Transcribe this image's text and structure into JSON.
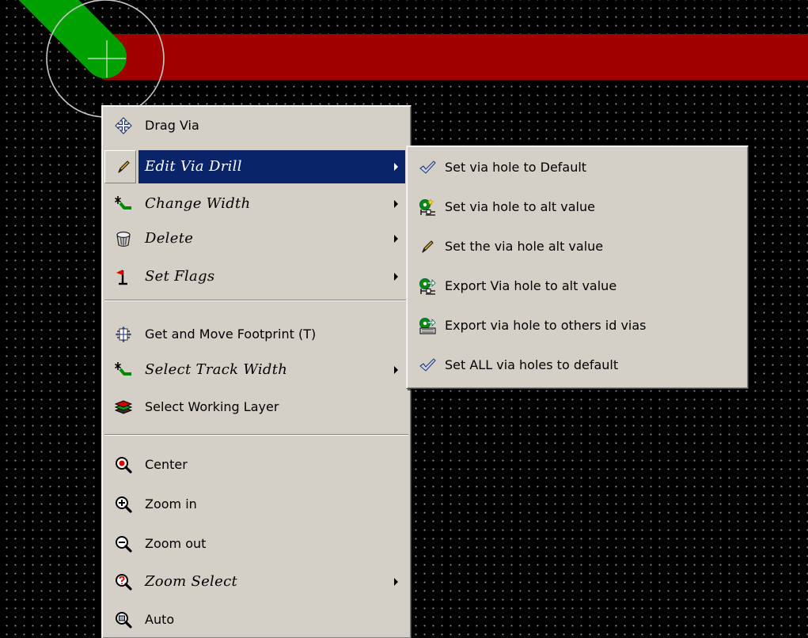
{
  "colors": {
    "canvas_background": "#000000",
    "grid_dot": "#8a8a8a",
    "track_red": "#a00000",
    "track_green": "#00a000",
    "menu_background": "#d4d0c8",
    "highlight": "#0a246a"
  },
  "context_menu": {
    "items": [
      {
        "label": "Drag Via",
        "icon": "drag-move-icon",
        "has_submenu": false
      },
      {
        "label": "Edit Via Drill",
        "icon": "pencil-icon",
        "has_submenu": true,
        "highlighted": true
      },
      {
        "label": "Change Width",
        "icon": "track-width-icon",
        "has_submenu": true
      },
      {
        "label": "Delete",
        "icon": "trash-icon",
        "has_submenu": true
      },
      {
        "label": "Set Flags",
        "icon": "flag-icon",
        "has_submenu": true
      },
      {
        "label": "Get and Move Footprint (T)",
        "icon": "move-footprint-icon",
        "has_submenu": false
      },
      {
        "label": "Select Track Width",
        "icon": "track-width-icon",
        "has_submenu": true
      },
      {
        "label": "Select Working Layer",
        "icon": "layers-icon",
        "has_submenu": false
      },
      {
        "label": "Center",
        "icon": "zoom-center-icon",
        "has_submenu": false
      },
      {
        "label": "Zoom in",
        "icon": "zoom-in-icon",
        "has_submenu": false
      },
      {
        "label": "Zoom out",
        "icon": "zoom-out-icon",
        "has_submenu": false
      },
      {
        "label": "Zoom Select",
        "icon": "zoom-select-icon",
        "has_submenu": true
      },
      {
        "label": "Auto",
        "icon": "zoom-auto-icon",
        "has_submenu": false
      }
    ]
  },
  "submenu": {
    "items": [
      {
        "label": "Set via hole to Default",
        "icon": "checkmark-icon"
      },
      {
        "label": "Set via hole to alt value",
        "icon": "via-alt-value-icon"
      },
      {
        "label": "Set the via hole alt value",
        "icon": "pencil-icon"
      },
      {
        "label": "Export Via hole to alt value",
        "icon": "via-export-icon"
      },
      {
        "label": "Export via hole to others id vias",
        "icon": "via-export-others-icon"
      },
      {
        "label": "Set ALL via holes to default",
        "icon": "checkmark-icon"
      }
    ]
  }
}
